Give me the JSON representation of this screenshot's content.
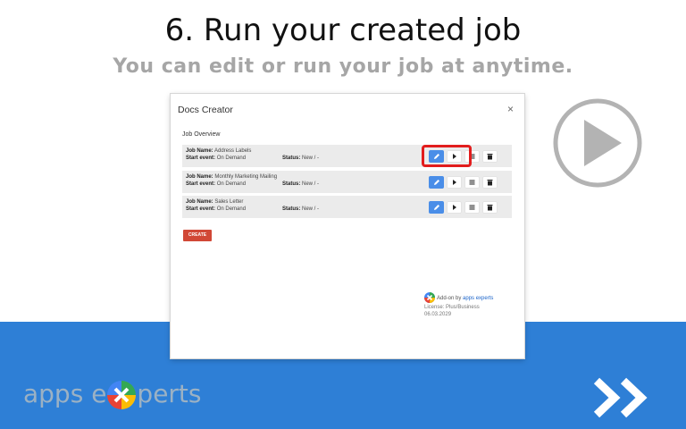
{
  "slide": {
    "title": "6. Run your created job",
    "subtitle": "You can edit or run your job at anytime."
  },
  "dialog": {
    "title": "Docs Creator",
    "close_glyph": "×",
    "overview_label": "Job Overview",
    "jobs": [
      {
        "name_label": "Job Name:",
        "name": "Address Labels",
        "start_label": "Start event:",
        "start": "On Demand",
        "status_label": "Status:",
        "status": "New / -"
      },
      {
        "name_label": "Job Name:",
        "name": "Monthly Marketing Mailing",
        "start_label": "Start event:",
        "start": "On Demand",
        "status_label": "Status:",
        "status": "New / -"
      },
      {
        "name_label": "Job Name:",
        "name": "Sales Letter",
        "start_label": "Start event:",
        "start": "On Demand",
        "status_label": "Status:",
        "status": "New / -"
      }
    ],
    "row_actions": [
      "edit-icon",
      "play-icon",
      "list-icon",
      "trash-icon"
    ],
    "create_label": "CREATE",
    "addon": {
      "prefix": "Add-on by",
      "brand_link": "apps experts",
      "license": "License: Plus/Business",
      "date": "06.03.2029"
    }
  },
  "branding": {
    "logo_text_left": "apps e",
    "logo_text_right": "perts"
  },
  "colors": {
    "accent_blue": "#2e7fd6",
    "edit_button": "#4a8ee8",
    "create_button": "#d14836",
    "highlight": "#e21d1d"
  }
}
